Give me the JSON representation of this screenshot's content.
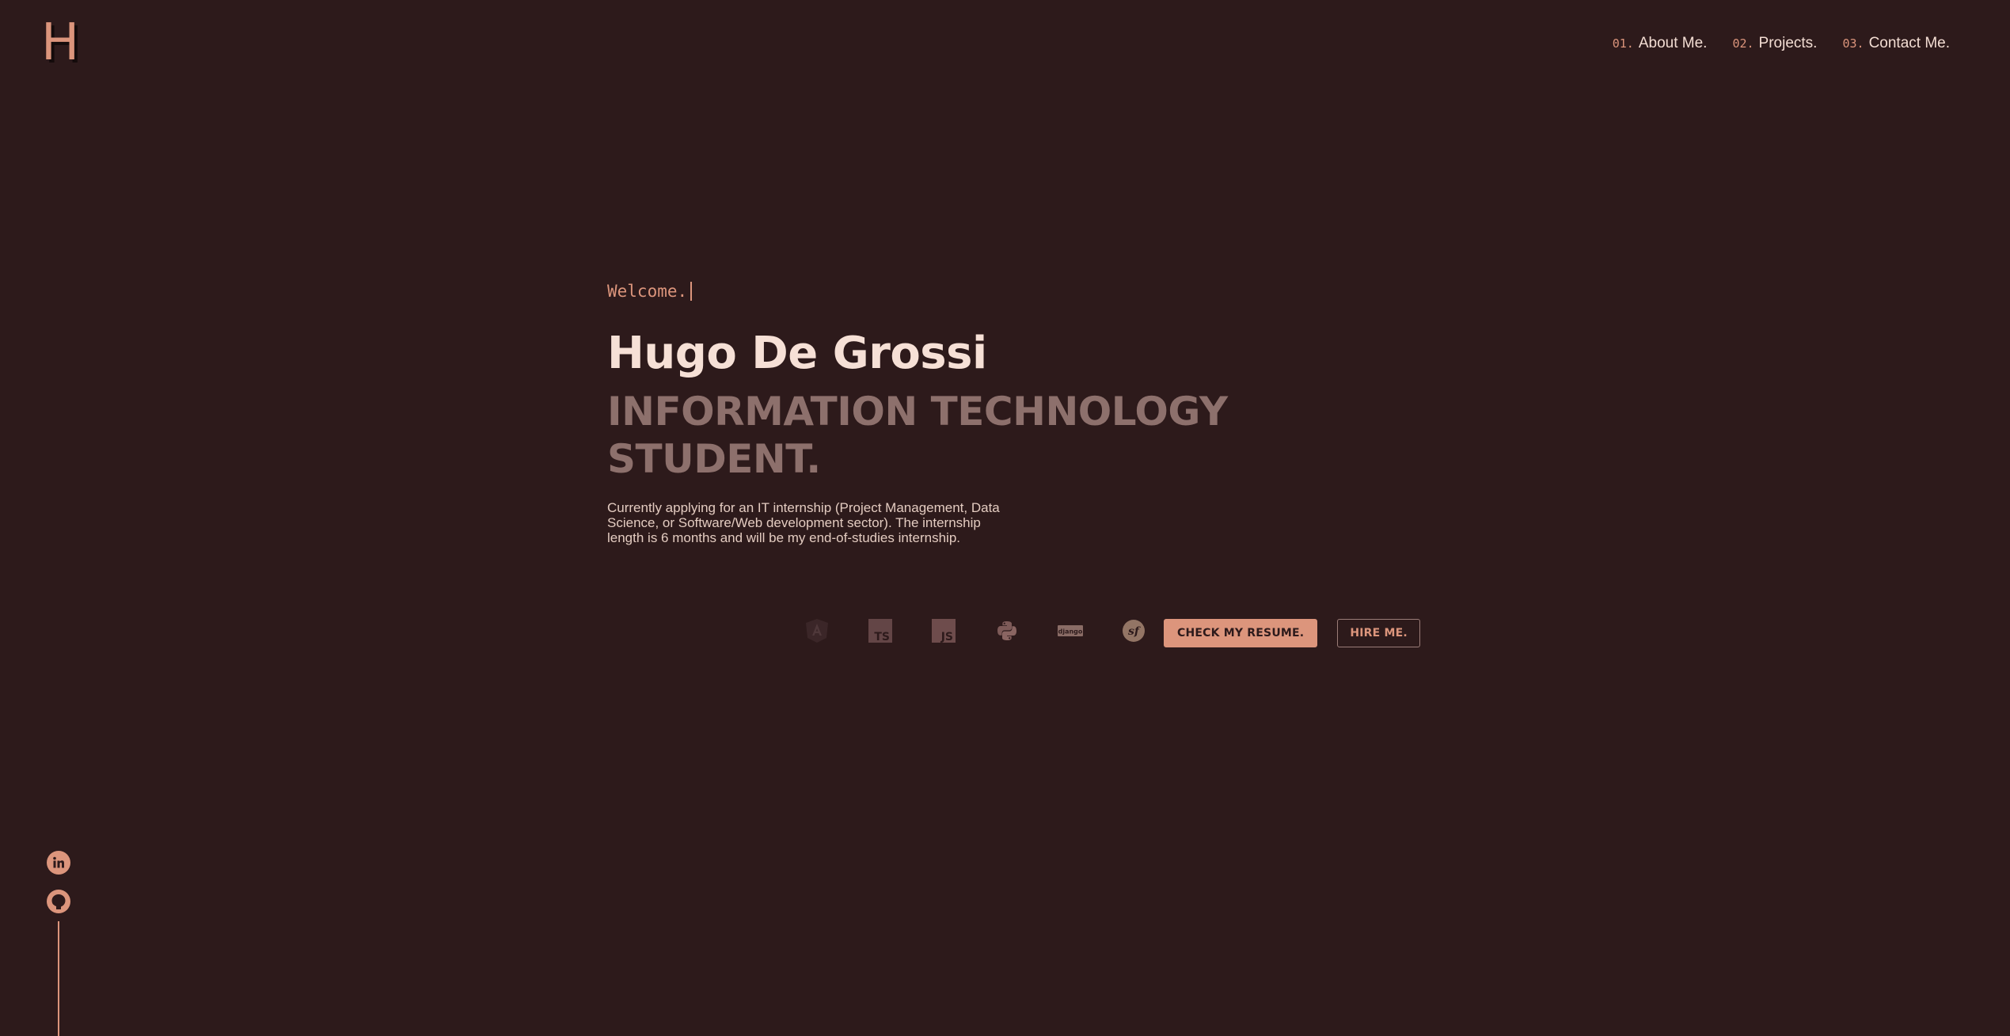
{
  "header": {
    "logo_letter": "H",
    "nav": [
      {
        "num": "01.",
        "label": "About Me."
      },
      {
        "num": "02.",
        "label": "Projects."
      },
      {
        "num": "03.",
        "label": "Contact Me."
      }
    ]
  },
  "hero": {
    "greeting": "Welcome.",
    "name": "Hugo De Grossi",
    "role": "INFORMATION TECHNOLOGY STUDENT.",
    "description": "Currently applying for an IT internship (Project Management, Data Science, or Software/Web development sector). The internship length is 6 months and will be my end-of-studies internship."
  },
  "tech_icons": [
    {
      "name": "angular-icon",
      "label": ""
    },
    {
      "name": "typescript-icon",
      "label": "TS"
    },
    {
      "name": "javascript-icon",
      "label": "JS"
    },
    {
      "name": "python-icon",
      "label": ""
    },
    {
      "name": "django-icon",
      "label": "django"
    },
    {
      "name": "symfony-icon",
      "label": "sf"
    }
  ],
  "actions": {
    "resume_label": "CHECK MY RESUME.",
    "hire_label": "HIRE ME."
  },
  "social": [
    "linkedin-icon",
    "github-icon"
  ],
  "colors": {
    "background": "#2d1a1b",
    "accent": "#dc957c",
    "text": "#f3ddd3",
    "muted": "#8d706c"
  }
}
